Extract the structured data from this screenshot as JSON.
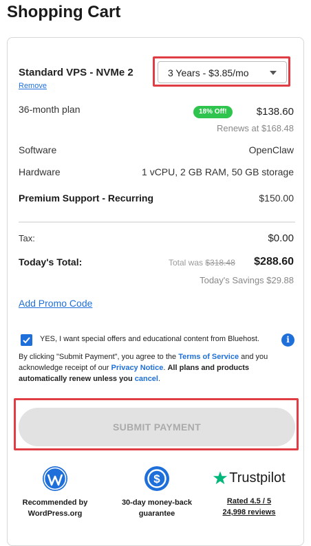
{
  "page": {
    "title": "Shopping Cart"
  },
  "product": {
    "name": "Standard VPS - NVMe 2",
    "remove_label": "Remove",
    "term_selected": "3 Years - $3.85/mo"
  },
  "plan": {
    "label": "36-month plan",
    "discount_badge": "18% Off!",
    "price": "$138.60",
    "renews": "Renews at $168.48"
  },
  "details": [
    {
      "label": "Software",
      "value": "OpenClaw"
    },
    {
      "label": "Hardware",
      "value": "1 vCPU, 2 GB RAM, 50 GB storage"
    }
  ],
  "addon": {
    "label": "Premium Support - Recurring",
    "value": "$150.00"
  },
  "summary": {
    "tax_label": "Tax:",
    "tax_value": "$0.00",
    "total_label": "Today's Total:",
    "total_was_prefix": "Total was",
    "total_was_value": "$318.48",
    "total_value": "$288.60",
    "savings": "Today's Savings $29.88"
  },
  "promo": {
    "label": "Add Promo Code"
  },
  "consent": {
    "checked": true,
    "label": "YES, I want special offers and educational content from Bluehost.",
    "info_icon": "i"
  },
  "legal": {
    "part1": "By clicking \"Submit Payment\", you agree to the",
    "terms_link": "Terms of Service",
    "part2": "and you acknowledge receipt of our",
    "privacy_link": "Privacy Notice",
    "part3": ".",
    "strong": "All plans and products automatically renew unless you",
    "cancel_link": "cancel",
    "part4": "."
  },
  "submit": {
    "label": "SUBMIT PAYMENT"
  },
  "badges": {
    "wordpress": {
      "line1": "Recommended by",
      "line2": "WordPress.org"
    },
    "moneyback": {
      "line1": "30-day money-back",
      "line2": "guarantee"
    },
    "trustpilot": {
      "brand": "Trustpilot",
      "line1": "Rated 4.5 / 5",
      "line2": "24,998 reviews"
    }
  },
  "colors": {
    "accent": "#1e6fd9",
    "highlight": "#e03c44",
    "badge_green": "#2ec44d",
    "trustpilot_green": "#00b67a"
  }
}
